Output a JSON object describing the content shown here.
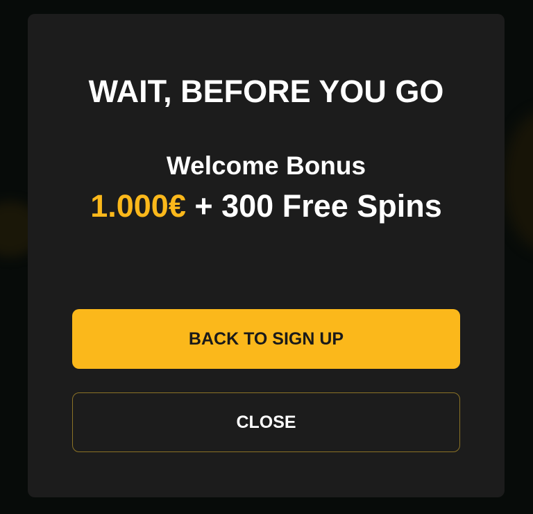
{
  "modal": {
    "title": "WAIT, BEFORE YOU GO",
    "subtitle": "Welcome Bonus",
    "offer_amount": "1.000€",
    "offer_rest": " + 300 Free Spins",
    "primary_button_label": "BACK TO SIGN UP",
    "secondary_button_label": "CLOSE"
  },
  "colors": {
    "accent": "#fbb81b",
    "modal_background": "#1c1c1c",
    "page_background": "#070b09",
    "secondary_border": "#8c7326"
  }
}
